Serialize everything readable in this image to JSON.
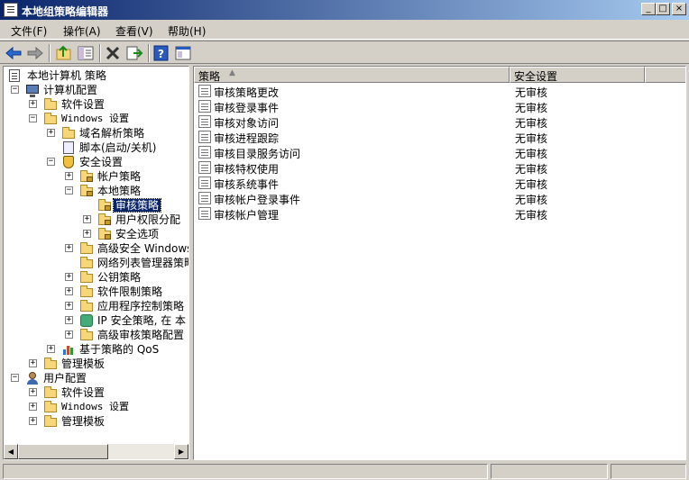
{
  "window": {
    "title": "本地组策略编辑器",
    "controls": [
      "_",
      "□",
      "×"
    ]
  },
  "menu": [
    "文件(F)",
    "操作(A)",
    "查看(V)",
    "帮助(H)"
  ],
  "toolbar": {
    "buttons": [
      "back-icon",
      "forward-icon",
      "up-folder-icon",
      "show-hide-tree-icon",
      "delete-icon",
      "export-list-icon",
      "help-icon",
      "properties-icon"
    ]
  },
  "tree": {
    "root": "本地计算机 策略",
    "computer_config": "计算机配置",
    "software_settings_1": "软件设置",
    "windows_settings_1": "Windows 设置",
    "name_resolution": "域名解析策略",
    "scripts": "脚本(启动/关机)",
    "security_settings": "安全设置",
    "account_policies": "帐户策略",
    "local_policies": "本地策略",
    "audit_policy": "审核策略",
    "user_rights": "用户权限分配",
    "security_options": "安全选项",
    "advanced_firewall": "高级安全 Windows",
    "network_list": "网络列表管理器策略",
    "public_key": "公钥策略",
    "software_restriction": "软件限制策略",
    "app_control": "应用程序控制策略",
    "ip_security": "IP 安全策略, 在 本",
    "advanced_audit": "高级审核策略配置",
    "qos": "基于策略的 QoS",
    "admin_templates_1": "管理模板",
    "user_config": "用户配置",
    "software_settings_2": "软件设置",
    "windows_settings_2": "Windows 设置",
    "admin_templates_2": "管理模板"
  },
  "list": {
    "columns": [
      "策略",
      "安全设置"
    ],
    "rows": [
      {
        "policy": "审核策略更改",
        "setting": "无审核"
      },
      {
        "policy": "审核登录事件",
        "setting": "无审核"
      },
      {
        "policy": "审核对象访问",
        "setting": "无审核"
      },
      {
        "policy": "审核进程跟踪",
        "setting": "无审核"
      },
      {
        "policy": "审核目录服务访问",
        "setting": "无审核"
      },
      {
        "policy": "审核特权使用",
        "setting": "无审核"
      },
      {
        "policy": "审核系统事件",
        "setting": "无审核"
      },
      {
        "policy": "审核帐户登录事件",
        "setting": "无审核"
      },
      {
        "policy": "审核帐户管理",
        "setting": "无审核"
      }
    ]
  },
  "colors": {
    "titlebar_start": "#0a246a",
    "titlebar_end": "#a6caf0",
    "selection": "#0a246a",
    "chrome": "#d4d0c8"
  }
}
